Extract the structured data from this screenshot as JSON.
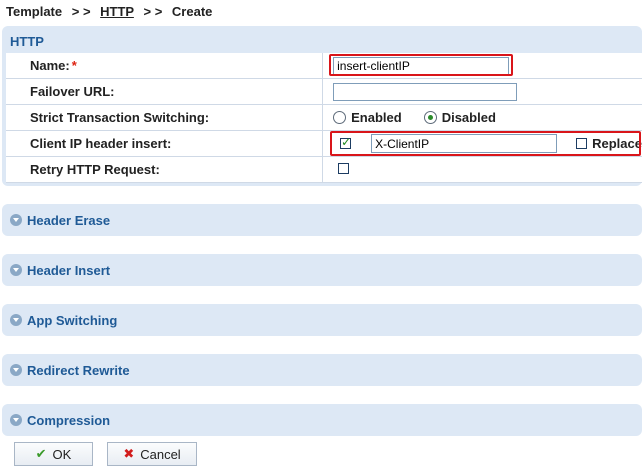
{
  "breadcrumb": {
    "root": "Template",
    "sep1": "> >",
    "link": "HTTP",
    "sep2": "> >",
    "current": "Create"
  },
  "panel": {
    "title": "HTTP"
  },
  "fields": {
    "name": {
      "label": "Name:",
      "required": "*",
      "value": "insert-clientIP"
    },
    "failover": {
      "label": "Failover URL:",
      "value": ""
    },
    "strict": {
      "label": "Strict Transaction Switching:",
      "opt_enabled": "Enabled",
      "opt_disabled": "Disabled",
      "selected": "Disabled"
    },
    "client_ip": {
      "label": "Client IP header insert:",
      "checked": true,
      "value": "X-ClientIP",
      "replace_label": "Replace",
      "replace_checked": false
    },
    "retry": {
      "label": "Retry HTTP Request:",
      "checked": false
    }
  },
  "sections": [
    {
      "label": "Header Erase"
    },
    {
      "label": "Header Insert"
    },
    {
      "label": "App Switching"
    },
    {
      "label": "Redirect Rewrite"
    },
    {
      "label": "Compression"
    }
  ],
  "buttons": {
    "ok": "OK",
    "cancel": "Cancel"
  },
  "colors": {
    "accent": "#1f5a96",
    "panel_bg": "#dde8f5",
    "highlight": "#d9151a"
  }
}
